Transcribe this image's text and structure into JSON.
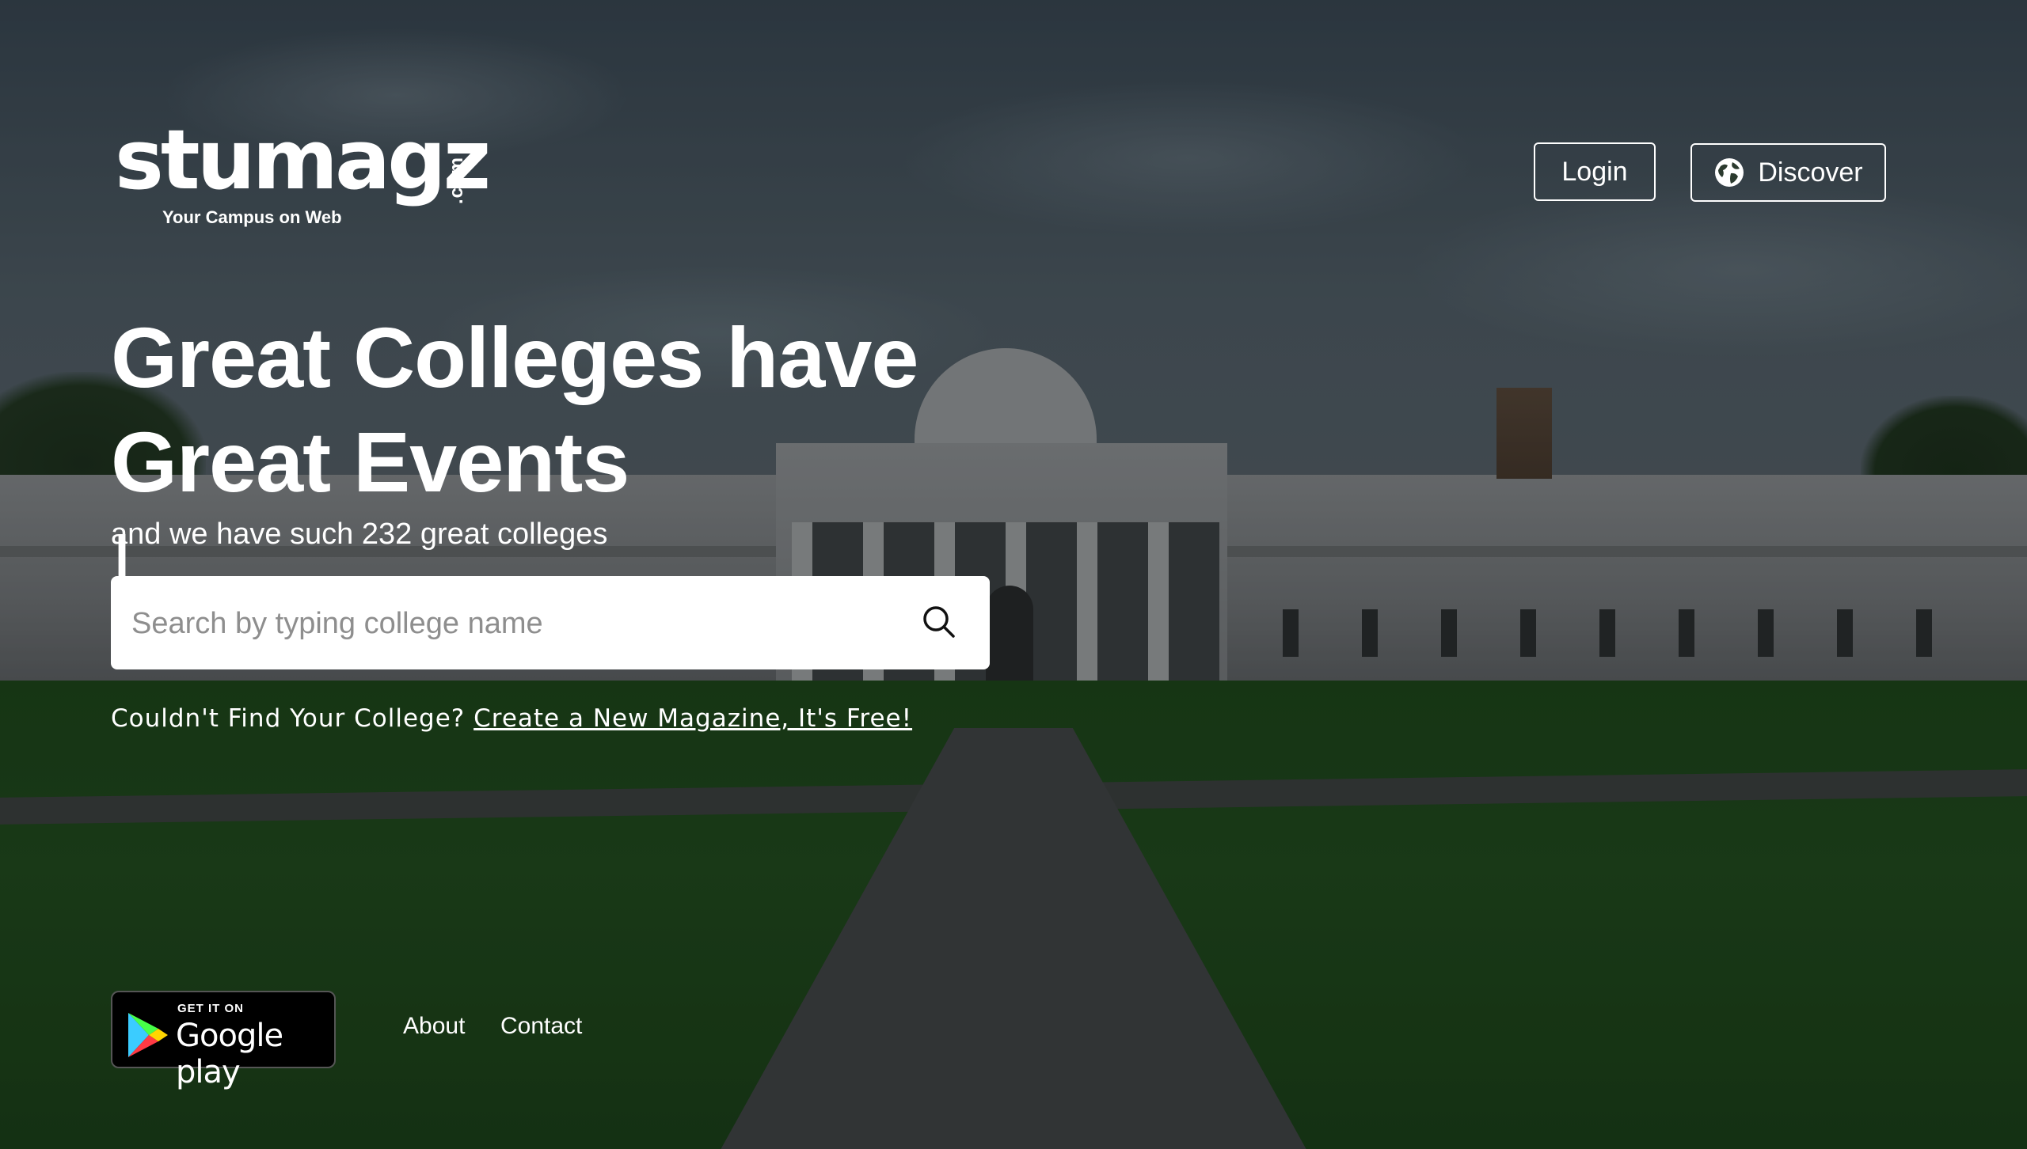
{
  "brand": {
    "name": "stumagz",
    "domain_suffix": ".com",
    "tagline": "Your Campus on Web"
  },
  "header": {
    "login_label": "Login",
    "discover_label": "Discover",
    "discover_icon": "globe-icon"
  },
  "hero": {
    "headline_line1": "Great Colleges have",
    "headline_line2": "Great Events",
    "typing_cursor": "|",
    "subline": "and we have such 232 great colleges"
  },
  "search": {
    "placeholder": "Search by typing college name",
    "value": "",
    "icon": "search-icon"
  },
  "cta": {
    "prompt": "Couldn't Find Your College?",
    "link_label": "Create a New Magazine, It's Free!"
  },
  "footer": {
    "store_badge": {
      "small_text": "GET IT ON",
      "big_text": "Google play",
      "icon": "google-play-icon"
    },
    "links": [
      {
        "label": "About"
      },
      {
        "label": "Contact"
      }
    ]
  },
  "colors": {
    "text": "#ffffff",
    "search_bg": "#ffffff",
    "badge_bg": "#000000"
  }
}
